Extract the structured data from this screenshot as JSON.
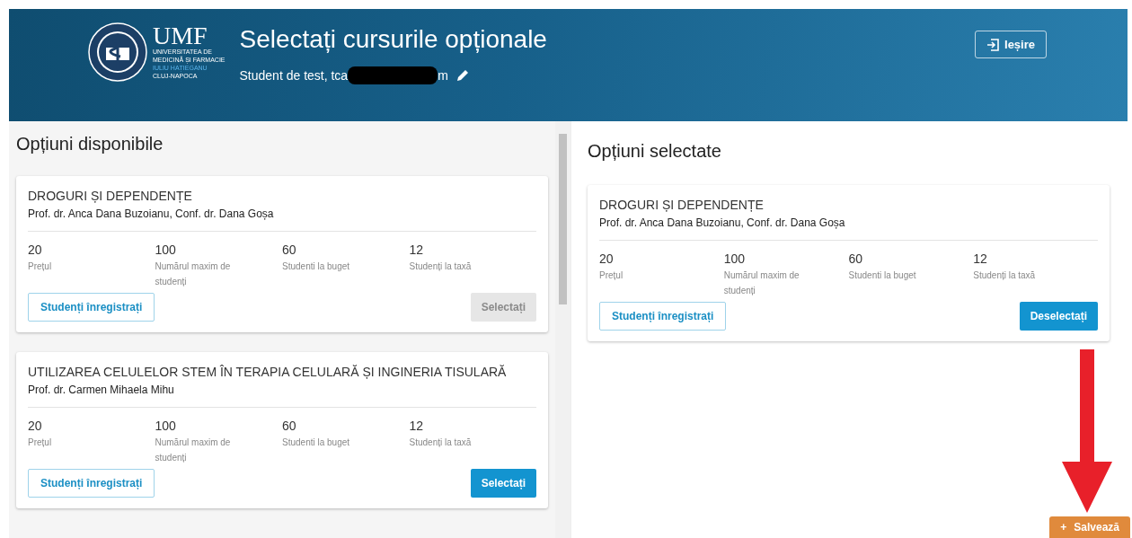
{
  "header": {
    "logo": {
      "abbr": "UMF",
      "line_1": "UNIVERSITATEA DE",
      "line_2": "MEDICINĂ ȘI FARMACIE",
      "line_3": "IULIU HAȚIEGANU",
      "line_4": "CLUJ-NAPOCA"
    },
    "title": "Selectați cursurile opționale",
    "user_start": "Student de test, tca",
    "user_end": "m",
    "logout": "Ieșire"
  },
  "available": {
    "title": "Opțiuni disponibile",
    "courses": [
      {
        "name": "DROGURI ȘI DEPENDENȚE",
        "teachers": "Prof. dr. Anca Dana Buzoianu, Conf. dr. Dana Goșa",
        "stats": [
          {
            "value": "20",
            "label": "Prețul"
          },
          {
            "value": "100",
            "label": "Numărul maxim de studenți"
          },
          {
            "value": "60",
            "label": "Studenti la buget"
          },
          {
            "value": "12",
            "label": "Studenți la taxă"
          }
        ],
        "registered": "Studenți înregistrați",
        "action": "Selectați",
        "disabled": true
      },
      {
        "name": "UTILIZAREA CELULELOR STEM ÎN TERAPIA CELULARĂ ȘI INGINERIA TISULARĂ",
        "teachers": "Prof. dr. Carmen Mihaela Mihu",
        "stats": [
          {
            "value": "20",
            "label": "Prețul"
          },
          {
            "value": "100",
            "label": "Numărul maxim de studenți"
          },
          {
            "value": "60",
            "label": "Studenti la buget"
          },
          {
            "value": "12",
            "label": "Studenți la taxă"
          }
        ],
        "registered": "Studenți înregistrați",
        "action": "Selectați",
        "disabled": false
      }
    ]
  },
  "selected": {
    "title": "Opțiuni selectate",
    "courses": [
      {
        "name": "DROGURI ȘI DEPENDENȚE",
        "teachers": "Prof. dr. Anca Dana Buzoianu, Conf. dr. Dana Goșa",
        "stats": [
          {
            "value": "20",
            "label": "Prețul"
          },
          {
            "value": "100",
            "label": "Numărul maxim de studenți"
          },
          {
            "value": "60",
            "label": "Studenti la buget"
          },
          {
            "value": "12",
            "label": "Studenți la taxă"
          }
        ],
        "registered": "Studenți înregistrați",
        "action": "Deselectați",
        "disabled": false
      }
    ]
  },
  "save": {
    "icon": "+",
    "label": "Salvează"
  }
}
